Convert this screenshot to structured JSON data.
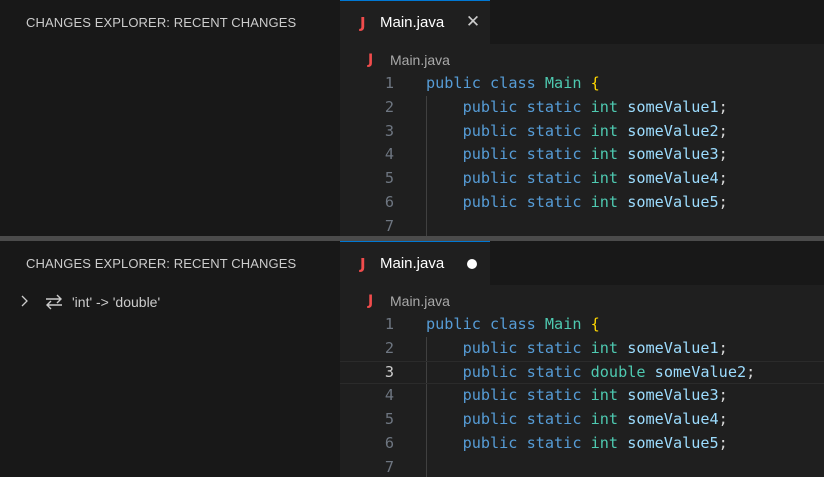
{
  "colors": {
    "tab_accent": "#0078d4",
    "java_icon": "#f14c4c",
    "keyword": "#569cd6",
    "type": "#4ec9b0",
    "identifier": "#9cdcfe",
    "brace": "#ffd700"
  },
  "panels": [
    {
      "sidebar": {
        "title": "CHANGES EXPLORER: RECENT CHANGES",
        "items": []
      },
      "tab": {
        "icon": "J",
        "label": "Main.java",
        "state": "close",
        "close_glyph": "✕"
      },
      "breadcrumb": {
        "icon": "J",
        "label": "Main.java"
      },
      "lines": [
        {
          "num": "1",
          "tokens": [
            {
              "t": "public",
              "k": "kw"
            },
            {
              "t": " "
            },
            {
              "t": "class",
              "k": "kw"
            },
            {
              "t": " "
            },
            {
              "t": "Main",
              "k": "ty"
            },
            {
              "t": " "
            },
            {
              "t": "{",
              "k": "br"
            }
          ]
        },
        {
          "num": "2",
          "tokens": [
            {
              "t": "    "
            },
            {
              "t": "public",
              "k": "kw"
            },
            {
              "t": " "
            },
            {
              "t": "static",
              "k": "kw"
            },
            {
              "t": " "
            },
            {
              "t": "int",
              "k": "ty"
            },
            {
              "t": " "
            },
            {
              "t": "someValue1",
              "k": "id"
            },
            {
              "t": ";",
              "k": "pn"
            }
          ]
        },
        {
          "num": "3",
          "tokens": [
            {
              "t": "    "
            },
            {
              "t": "public",
              "k": "kw"
            },
            {
              "t": " "
            },
            {
              "t": "static",
              "k": "kw"
            },
            {
              "t": " "
            },
            {
              "t": "int",
              "k": "ty"
            },
            {
              "t": " "
            },
            {
              "t": "someValue2",
              "k": "id"
            },
            {
              "t": ";",
              "k": "pn"
            }
          ]
        },
        {
          "num": "4",
          "tokens": [
            {
              "t": "    "
            },
            {
              "t": "public",
              "k": "kw"
            },
            {
              "t": " "
            },
            {
              "t": "static",
              "k": "kw"
            },
            {
              "t": " "
            },
            {
              "t": "int",
              "k": "ty"
            },
            {
              "t": " "
            },
            {
              "t": "someValue3",
              "k": "id"
            },
            {
              "t": ";",
              "k": "pn"
            }
          ]
        },
        {
          "num": "5",
          "tokens": [
            {
              "t": "    "
            },
            {
              "t": "public",
              "k": "kw"
            },
            {
              "t": " "
            },
            {
              "t": "static",
              "k": "kw"
            },
            {
              "t": " "
            },
            {
              "t": "int",
              "k": "ty"
            },
            {
              "t": " "
            },
            {
              "t": "someValue4",
              "k": "id"
            },
            {
              "t": ";",
              "k": "pn"
            }
          ]
        },
        {
          "num": "6",
          "tokens": [
            {
              "t": "    "
            },
            {
              "t": "public",
              "k": "kw"
            },
            {
              "t": " "
            },
            {
              "t": "static",
              "k": "kw"
            },
            {
              "t": " "
            },
            {
              "t": "int",
              "k": "ty"
            },
            {
              "t": " "
            },
            {
              "t": "someValue5",
              "k": "id"
            },
            {
              "t": ";",
              "k": "pn"
            }
          ]
        },
        {
          "num": "7",
          "tokens": []
        }
      ]
    },
    {
      "sidebar": {
        "title": "CHANGES EXPLORER: RECENT CHANGES",
        "items": [
          {
            "label": "'int' -> 'double'",
            "icon": "swap-arrows-icon",
            "expanded": false
          }
        ]
      },
      "tab": {
        "icon": "J",
        "label": "Main.java",
        "state": "dirty"
      },
      "breadcrumb": {
        "icon": "J",
        "label": "Main.java"
      },
      "current_line": "3",
      "lines": [
        {
          "num": "1",
          "tokens": [
            {
              "t": "public",
              "k": "kw"
            },
            {
              "t": " "
            },
            {
              "t": "class",
              "k": "kw"
            },
            {
              "t": " "
            },
            {
              "t": "Main",
              "k": "ty"
            },
            {
              "t": " "
            },
            {
              "t": "{",
              "k": "br"
            }
          ]
        },
        {
          "num": "2",
          "tokens": [
            {
              "t": "    "
            },
            {
              "t": "public",
              "k": "kw"
            },
            {
              "t": " "
            },
            {
              "t": "static",
              "k": "kw"
            },
            {
              "t": " "
            },
            {
              "t": "int",
              "k": "ty"
            },
            {
              "t": " "
            },
            {
              "t": "someValue1",
              "k": "id"
            },
            {
              "t": ";",
              "k": "pn"
            }
          ]
        },
        {
          "num": "3",
          "tokens": [
            {
              "t": "    "
            },
            {
              "t": "public",
              "k": "kw"
            },
            {
              "t": " "
            },
            {
              "t": "static",
              "k": "kw"
            },
            {
              "t": " "
            },
            {
              "t": "double",
              "k": "ty"
            },
            {
              "t": " "
            },
            {
              "t": "someValue2",
              "k": "id"
            },
            {
              "t": ";",
              "k": "pn"
            }
          ]
        },
        {
          "num": "4",
          "tokens": [
            {
              "t": "    "
            },
            {
              "t": "public",
              "k": "kw"
            },
            {
              "t": " "
            },
            {
              "t": "static",
              "k": "kw"
            },
            {
              "t": " "
            },
            {
              "t": "int",
              "k": "ty"
            },
            {
              "t": " "
            },
            {
              "t": "someValue3",
              "k": "id"
            },
            {
              "t": ";",
              "k": "pn"
            }
          ]
        },
        {
          "num": "5",
          "tokens": [
            {
              "t": "    "
            },
            {
              "t": "public",
              "k": "kw"
            },
            {
              "t": " "
            },
            {
              "t": "static",
              "k": "kw"
            },
            {
              "t": " "
            },
            {
              "t": "int",
              "k": "ty"
            },
            {
              "t": " "
            },
            {
              "t": "someValue4",
              "k": "id"
            },
            {
              "t": ";",
              "k": "pn"
            }
          ]
        },
        {
          "num": "6",
          "tokens": [
            {
              "t": "    "
            },
            {
              "t": "public",
              "k": "kw"
            },
            {
              "t": " "
            },
            {
              "t": "static",
              "k": "kw"
            },
            {
              "t": " "
            },
            {
              "t": "int",
              "k": "ty"
            },
            {
              "t": " "
            },
            {
              "t": "someValue5",
              "k": "id"
            },
            {
              "t": ";",
              "k": "pn"
            }
          ]
        },
        {
          "num": "7",
          "tokens": []
        }
      ]
    }
  ]
}
